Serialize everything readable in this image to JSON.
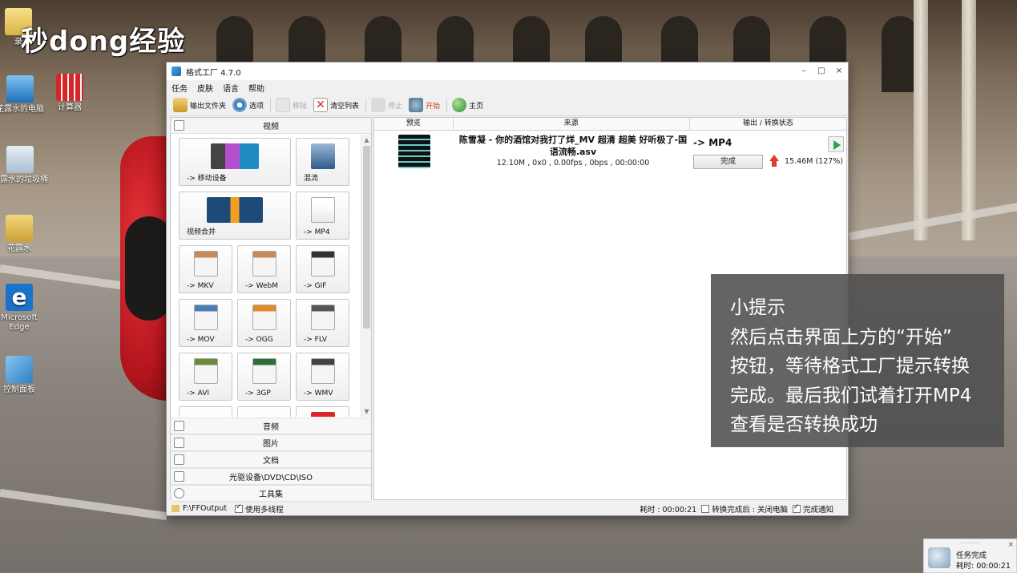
{
  "desktop": {
    "watermark": "秒dong经验",
    "icons": [
      {
        "label": "录",
        "name": "desktop-icon-folder-record"
      },
      {
        "label": "花露水的电脑",
        "name": "desktop-icon-computer"
      },
      {
        "label": "计算器",
        "name": "desktop-icon-calculator"
      },
      {
        "label": "花露水的垃圾桶",
        "name": "desktop-icon-recycle-bin"
      },
      {
        "label": "花露水",
        "name": "desktop-icon-user-folder"
      },
      {
        "label": "Microsoft Edge",
        "name": "desktop-icon-edge"
      },
      {
        "label": "控制面板",
        "name": "desktop-icon-control-panel"
      }
    ]
  },
  "window": {
    "title": "格式工厂 4.7.0",
    "controls": {
      "minimize": "–",
      "maximize": "□",
      "close": "×"
    },
    "menu": [
      "任务",
      "皮肤",
      "语言",
      "帮助"
    ],
    "toolbar": {
      "output_folder": "输出文件夹",
      "options": "选项",
      "remove": "移除",
      "clear_list": "清空列表",
      "stop": "停止",
      "start": "开始",
      "home": "主页"
    },
    "left_panel": {
      "video_category": "视频",
      "tiles": [
        {
          "label": "-> 移动设备"
        },
        {
          "label": "混流"
        },
        {
          "label": "视频合并"
        },
        {
          "label": "-> MP4"
        },
        {
          "label": "-> MKV"
        },
        {
          "label": "-> WebM"
        },
        {
          "label": "-> GIF"
        },
        {
          "label": "-> MOV"
        },
        {
          "label": "-> OGG"
        },
        {
          "label": "-> FLV"
        },
        {
          "label": "-> AVI"
        },
        {
          "label": "-> 3GP"
        },
        {
          "label": "-> WMV"
        }
      ],
      "bottom_categories": [
        "音频",
        "图片",
        "文档",
        "光驱设备\\DVD\\CD\\ISO",
        "工具集"
      ]
    },
    "table": {
      "headers": {
        "preview": "预览",
        "source": "来源",
        "output": "输出 / 转换状态"
      },
      "row": {
        "filename": "陈雪凝 - 你的酒馆对我打了烊_MV 超清 超美 好听极了-国语流畅.asv",
        "info": "12.10M , 0x0 , 0.00fps , 0bps , 00:00:00",
        "target": "-> MP4",
        "status_button": "完成",
        "output_size": "15.46M",
        "output_ratio": "(127%)"
      }
    },
    "statusbar": {
      "output_path": "F:\\FFOutput",
      "multithread": "使用多线程",
      "elapsed": "耗时 : 00:00:21",
      "after_done": "转换完成后 : 关闭电脑",
      "notify": "完成通知"
    }
  },
  "hint": {
    "lines": [
      "小提示",
      "然后点击界面上方的“开始”",
      "按钮，等待格式工厂提示转换",
      "完成。最后我们试着打开MP4",
      "查看是否转换成功"
    ]
  },
  "toast": {
    "title": "任务完成",
    "elapsed": "耗时: 00:00:21",
    "close": "×",
    "grip": "......"
  }
}
